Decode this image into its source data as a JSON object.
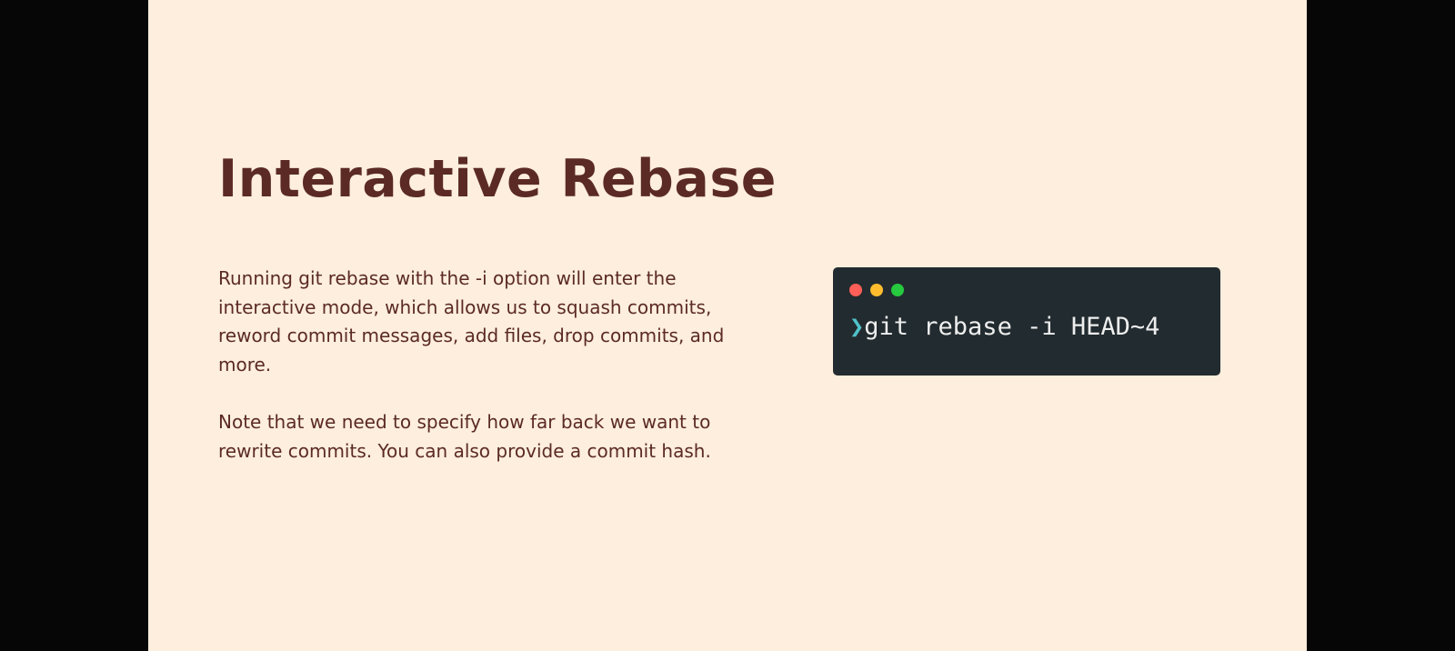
{
  "slide": {
    "title": "Interactive Rebase",
    "paragraphs": [
      "Running git rebase with the -i option will enter the interactive mode, which allows us to squash commits, reword commit messages, add files, drop commits, and more.",
      "Note that we need to specify how far back we want to rewrite commits. You can also provide a commit hash."
    ],
    "terminal": {
      "prompt_icon": "chevron-right-icon",
      "prompt_glyph": "❯",
      "command": "git rebase -i HEAD~4",
      "window_buttons": [
        "close-dot",
        "minimize-dot",
        "maximize-dot"
      ]
    }
  },
  "colors": {
    "slide_background": "#fdeedd",
    "letterbox": "#060606",
    "text": "#5b2a24",
    "terminal_background": "#222b2f",
    "terminal_text": "#eeeeee",
    "prompt": "#4fc1c9",
    "dot_red": "#ff5f56",
    "dot_yellow": "#ffbd2e",
    "dot_green": "#27c93f"
  }
}
